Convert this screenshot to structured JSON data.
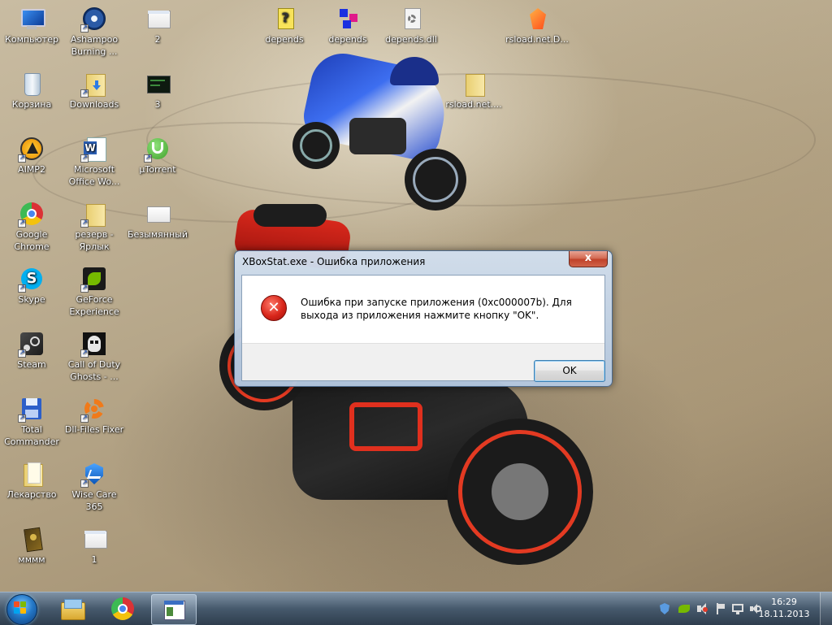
{
  "desktop": {
    "icons": [
      {
        "label": "Компьютер",
        "icon": "computer-icon"
      },
      {
        "label": "Ashampoo\nBurning ...",
        "icon": "ashampoo-icon"
      },
      {
        "label": "2",
        "icon": "document-icon"
      },
      {
        "label": "Корзина",
        "icon": "recycle-bin-icon"
      },
      {
        "label": "Downloads",
        "icon": "folder-icon"
      },
      {
        "label": "3",
        "icon": "image-icon"
      },
      {
        "label": "AIMP2",
        "icon": "aimp-icon"
      },
      {
        "label": "Microsoft\nOffice Wo...",
        "icon": "word-icon"
      },
      {
        "label": "µTorrent",
        "icon": "utorrent-icon"
      },
      {
        "label": "Google\nChrome",
        "icon": "chrome-icon"
      },
      {
        "label": "резерв -\nЯрлык",
        "icon": "folder-icon"
      },
      {
        "label": "Безымянный",
        "icon": "image-icon"
      },
      {
        "label": "Skype",
        "icon": "skype-icon"
      },
      {
        "label": "GeForce\nExperience",
        "icon": "geforce-icon"
      },
      {
        "label": "Steam",
        "icon": "steam-icon"
      },
      {
        "label": "Call of Duty\nGhosts - ...",
        "icon": "cod-ghosts-icon"
      },
      {
        "label": "Total\nCommander",
        "icon": "total-commander-icon"
      },
      {
        "label": "Dll-Files Fixer",
        "icon": "dll-fixer-icon"
      },
      {
        "label": "Лекарство",
        "icon": "folder-icon"
      },
      {
        "label": "Wise Care 365",
        "icon": "wise-care-icon"
      },
      {
        "label": "мммм",
        "icon": "archive-icon"
      },
      {
        "label": "1",
        "icon": "document-icon"
      },
      {
        "label": "depends",
        "icon": "depends-help-icon"
      },
      {
        "label": "depends",
        "icon": "depends-app-icon"
      },
      {
        "label": "depends.dll",
        "icon": "dll-file-icon"
      },
      {
        "label": "rsload.net.D...",
        "icon": "rsload-icon"
      },
      {
        "label": "rsload.net....",
        "icon": "folder-icon"
      }
    ]
  },
  "dialog": {
    "title": "XBoxStat.exe - Ошибка приложения",
    "close_label": "x",
    "error_glyph": "✕",
    "message": "Ошибка при запуске приложения (0xc000007b). Для выхода из приложения нажмите кнопку \"OK\".",
    "ok_label": "OK"
  },
  "taskbar": {
    "pinned": [
      "explorer-icon",
      "chrome-icon",
      "application-icon"
    ],
    "clock_time": "16:29",
    "clock_date": "18.11.2013"
  }
}
